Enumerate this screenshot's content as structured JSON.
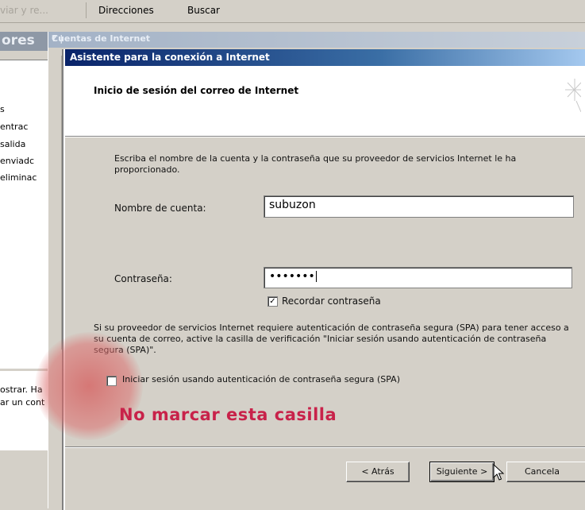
{
  "toolbar": {
    "item_faded": "viar y re...",
    "directions": "Direcciones",
    "search": "Buscar"
  },
  "background_app": {
    "title_partial": "ores",
    "folders": [
      "s",
      "entrac",
      "salida",
      "enviadc",
      "eliminac"
    ],
    "bottom_text": [
      "ostrar. Ha",
      "ar un cont"
    ]
  },
  "accounts_dialog": {
    "title": "Cuentas de Internet",
    "help": "? |"
  },
  "wizard": {
    "title": "Asistente para la conexión a Internet",
    "header_title": "Inicio de sesión del correo de Internet",
    "intro": "Escriba el nombre de la cuenta y la contraseña que su proveedor de servicios Internet le ha proporcionado.",
    "account_label": "Nombre de cuenta:",
    "account_value": "subuzon",
    "password_label": "Contraseña:",
    "password_value": "•••••••",
    "remember_label": "Recordar contraseña",
    "remember_checked": true,
    "spa_description": "Si su proveedor de servicios Internet requiere autenticación de contraseña segura (SPA) para tener acceso a su cuenta de correo, active la casilla de verificación \"Iniciar sesión usando autenticación de contraseña segura (SPA)\".",
    "spa_label": "Iniciar sesión usando autenticación de contraseña segura (SPA)",
    "spa_checked": false,
    "annotation": "No marcar esta casilla",
    "buttons": {
      "back": "< Atrás",
      "next": "Siguiente >",
      "cancel": "Cancela"
    }
  },
  "colors": {
    "titlebar_start": "#0a246a",
    "titlebar_end": "#a6caf0",
    "annotation": "#c8224a",
    "highlight": "#d65a5a"
  }
}
